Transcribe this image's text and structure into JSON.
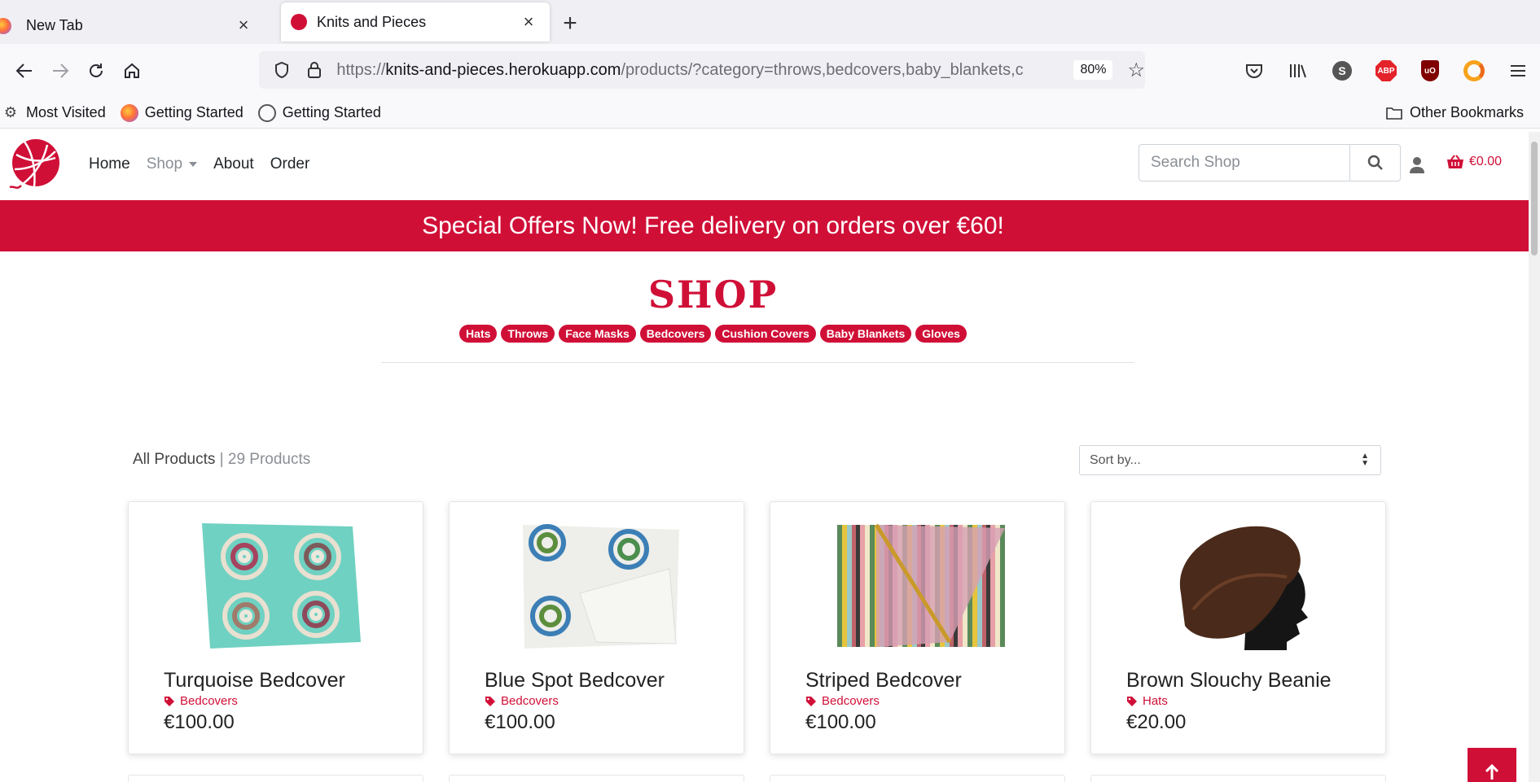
{
  "browser": {
    "tabs": [
      {
        "label": "New Tab"
      },
      {
        "label": "Knits and Pieces"
      }
    ],
    "url": {
      "prefix": "https://",
      "host": "knits-and-pieces.herokuapp.com",
      "path": "/products/?category=throws,bedcovers,baby_blankets,c"
    },
    "zoom": "80%",
    "bookmarks": [
      "Most Visited",
      "Getting Started",
      "Getting Started"
    ],
    "other_bookmarks": "Other Bookmarks",
    "ext_s": "S",
    "ext_abp": "ABP",
    "ext_ub": "uO"
  },
  "site": {
    "nav": {
      "home": "Home",
      "shop": "Shop",
      "about": "About",
      "order": "Order"
    },
    "search_placeholder": "Search Shop",
    "cart_total": "€0.00",
    "banner": "Special Offers Now! Free delivery on orders over €60!",
    "shop_title": "SHOP",
    "categories": [
      "Hats",
      "Throws",
      "Face Masks",
      "Bedcovers",
      "Cushion Covers",
      "Baby Blankets",
      "Gloves"
    ],
    "count": {
      "all": "All Products",
      "sep": "|",
      "total": "29 Products"
    },
    "sort": "Sort by...",
    "products": [
      {
        "name": "Turquoise Bedcover",
        "category": "Bedcovers",
        "price": "€100.00"
      },
      {
        "name": "Blue Spot Bedcover",
        "category": "Bedcovers",
        "price": "€100.00"
      },
      {
        "name": "Striped Bedcover",
        "category": "Bedcovers",
        "price": "€100.00"
      },
      {
        "name": "Brown Slouchy Beanie",
        "category": "Hats",
        "price": "€20.00"
      }
    ],
    "colors": {
      "brand": "#d00f37"
    }
  }
}
